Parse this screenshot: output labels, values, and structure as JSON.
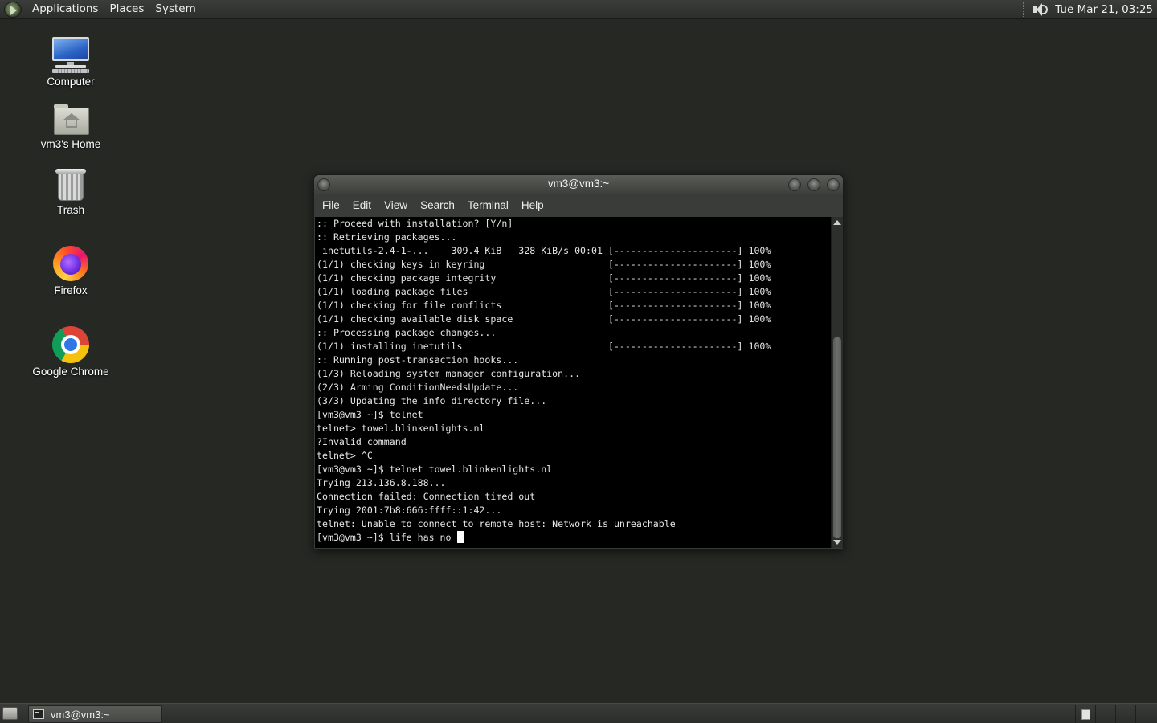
{
  "top_panel": {
    "menus": [
      "Applications",
      "Places",
      "System"
    ],
    "clock": "Tue Mar 21, 03:25",
    "icons": [
      "distro-logo-icon",
      "speaker-icon"
    ]
  },
  "desktop": {
    "icons": [
      {
        "label": "Computer",
        "icon": "computer-icon"
      },
      {
        "label": "vm3's Home",
        "icon": "home-folder-icon"
      },
      {
        "label": "Trash",
        "icon": "trash-icon"
      },
      {
        "label": "Firefox",
        "icon": "firefox-icon"
      },
      {
        "label": "Google Chrome",
        "icon": "chrome-icon"
      }
    ]
  },
  "terminal": {
    "title": "vm3@vm3:~",
    "menu": [
      "File",
      "Edit",
      "View",
      "Search",
      "Terminal",
      "Help"
    ],
    "lines": [
      ":: Proceed with installation? [Y/n]",
      ":: Retrieving packages...",
      " inetutils-2.4-1-...    309.4 KiB   328 KiB/s 00:01 [----------------------] 100%",
      "(1/1) checking keys in keyring                      [----------------------] 100%",
      "(1/1) checking package integrity                    [----------------------] 100%",
      "(1/1) loading package files                         [----------------------] 100%",
      "(1/1) checking for file conflicts                   [----------------------] 100%",
      "(1/1) checking available disk space                 [----------------------] 100%",
      ":: Processing package changes...",
      "(1/1) installing inetutils                          [----------------------] 100%",
      ":: Running post-transaction hooks...",
      "(1/3) Reloading system manager configuration...",
      "(2/3) Arming ConditionNeedsUpdate...",
      "(3/3) Updating the info directory file...",
      "[vm3@vm3 ~]$ telnet",
      "telnet> towel.blinkenlights.nl",
      "?Invalid command",
      "telnet> ^C",
      "[vm3@vm3 ~]$ telnet towel.blinkenlights.nl",
      "Trying 213.136.8.188...",
      "Connection failed: Connection timed out",
      "Trying 2001:7b8:666:ffff::1:42...",
      "telnet: Unable to connect to remote host: Network is unreachable"
    ],
    "prompt_line": "[vm3@vm3 ~]$ life has no "
  },
  "bottom_panel": {
    "task_label": "vm3@vm3:~",
    "workspaces": 4,
    "active_workspace": 1
  }
}
